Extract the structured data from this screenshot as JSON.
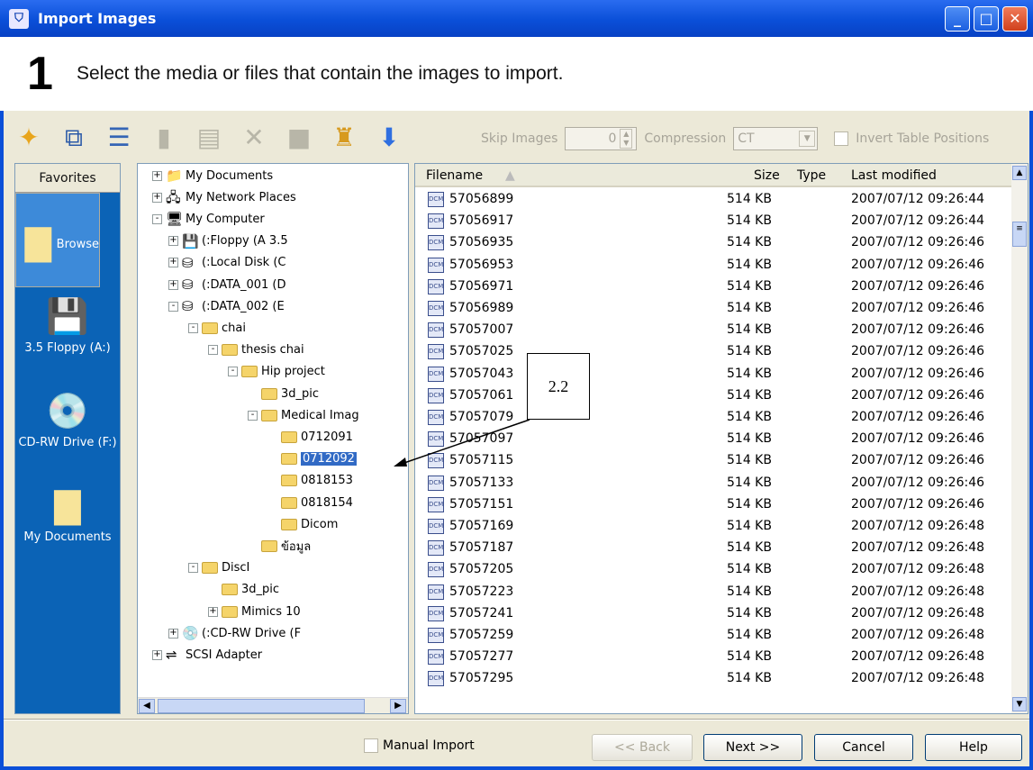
{
  "window": {
    "title": "Import Images"
  },
  "header": {
    "step_number": "1",
    "step_text": "Select the media or files that contain the images to import."
  },
  "options": {
    "skip_label": "Skip Images",
    "skip_value": "0",
    "compression_label": "Compression",
    "compression_value": "CT",
    "invert_label": "Invert Table Positions"
  },
  "favorites": {
    "header": "Favorites",
    "items": [
      {
        "label": "Browse",
        "icon": "folder-icon"
      },
      {
        "label": "3.5 Floppy (A:)",
        "icon": "floppy-icon"
      },
      {
        "label": "CD-RW Drive (F:)",
        "icon": "cd-drive-icon"
      },
      {
        "label": "My Documents",
        "icon": "documents-folder-icon"
      }
    ]
  },
  "tree": [
    {
      "label": "My Documents",
      "expander": "+",
      "icon": "documents-icon"
    },
    {
      "label": "My Network Places",
      "expander": "+",
      "icon": "network-icon"
    },
    {
      "label": "My Computer",
      "expander": "-",
      "icon": "computer-icon"
    },
    {
      "label": "(:Floppy (A 3.5",
      "expander": "+",
      "icon": "floppy-icon"
    },
    {
      "label": "(:Local Disk (C",
      "expander": "+",
      "icon": "disk-icon"
    },
    {
      "label": "(:DATA_001 (D",
      "expander": "+",
      "icon": "disk-icon"
    },
    {
      "label": "(:DATA_002 (E",
      "expander": "-",
      "icon": "disk-icon"
    },
    {
      "label": "chai",
      "expander": "-",
      "icon": "folder-icon"
    },
    {
      "label": "thesis chai",
      "expander": "-",
      "icon": "folder-icon"
    },
    {
      "label": "Hip project",
      "expander": "-",
      "icon": "folder-icon"
    },
    {
      "label": "3d_pic",
      "expander": "",
      "icon": "folder-icon"
    },
    {
      "label": "Medical Imag",
      "expander": "-",
      "icon": "folder-icon"
    },
    {
      "label": "0712091",
      "expander": "",
      "icon": "folder-icon"
    },
    {
      "label": "0712092",
      "expander": "",
      "icon": "folder-icon"
    },
    {
      "label": "0818153",
      "expander": "",
      "icon": "folder-icon"
    },
    {
      "label": "0818154",
      "expander": "",
      "icon": "folder-icon"
    },
    {
      "label": "Dicom",
      "expander": "",
      "icon": "folder-icon"
    },
    {
      "label": "ข้อมูล",
      "expander": "",
      "icon": "folder-icon"
    },
    {
      "label": "DiscI",
      "expander": "-",
      "icon": "folder-icon"
    },
    {
      "label": "3d_pic",
      "expander": "",
      "icon": "folder-icon"
    },
    {
      "label": "Mimics 10",
      "expander": "+",
      "icon": "folder-icon"
    },
    {
      "label": "(:CD-RW Drive (F",
      "expander": "+",
      "icon": "cd-icon"
    },
    {
      "label": "SCSI Adapter",
      "expander": "+",
      "icon": "scsi-icon"
    }
  ],
  "list": {
    "columns": {
      "filename": "Filename",
      "size": "Size",
      "type": "Type",
      "modified": "Last modified"
    },
    "rows": [
      {
        "name": "57056899",
        "size": "514 KB",
        "modified": "2007/07/12 09:26:44"
      },
      {
        "name": "57056917",
        "size": "514 KB",
        "modified": "2007/07/12 09:26:44"
      },
      {
        "name": "57056935",
        "size": "514 KB",
        "modified": "2007/07/12 09:26:46"
      },
      {
        "name": "57056953",
        "size": "514 KB",
        "modified": "2007/07/12 09:26:46"
      },
      {
        "name": "57056971",
        "size": "514 KB",
        "modified": "2007/07/12 09:26:46"
      },
      {
        "name": "57056989",
        "size": "514 KB",
        "modified": "2007/07/12 09:26:46"
      },
      {
        "name": "57057007",
        "size": "514 KB",
        "modified": "2007/07/12 09:26:46"
      },
      {
        "name": "57057025",
        "size": "514 KB",
        "modified": "2007/07/12 09:26:46"
      },
      {
        "name": "57057043",
        "size": "514 KB",
        "modified": "2007/07/12 09:26:46"
      },
      {
        "name": "57057061",
        "size": "514 KB",
        "modified": "2007/07/12 09:26:46"
      },
      {
        "name": "57057079",
        "size": "514 KB",
        "modified": "2007/07/12 09:26:46"
      },
      {
        "name": "57057097",
        "size": "514 KB",
        "modified": "2007/07/12 09:26:46"
      },
      {
        "name": "57057115",
        "size": "514 KB",
        "modified": "2007/07/12 09:26:46"
      },
      {
        "name": "57057133",
        "size": "514 KB",
        "modified": "2007/07/12 09:26:46"
      },
      {
        "name": "57057151",
        "size": "514 KB",
        "modified": "2007/07/12 09:26:46"
      },
      {
        "name": "57057169",
        "size": "514 KB",
        "modified": "2007/07/12 09:26:48"
      },
      {
        "name": "57057187",
        "size": "514 KB",
        "modified": "2007/07/12 09:26:48"
      },
      {
        "name": "57057205",
        "size": "514 KB",
        "modified": "2007/07/12 09:26:48"
      },
      {
        "name": "57057223",
        "size": "514 KB",
        "modified": "2007/07/12 09:26:48"
      },
      {
        "name": "57057241",
        "size": "514 KB",
        "modified": "2007/07/12 09:26:48"
      },
      {
        "name": "57057259",
        "size": "514 KB",
        "modified": "2007/07/12 09:26:48"
      },
      {
        "name": "57057277",
        "size": "514 KB",
        "modified": "2007/07/12 09:26:48"
      },
      {
        "name": "57057295",
        "size": "514 KB",
        "modified": "2007/07/12 09:26:48"
      }
    ]
  },
  "footer": {
    "manual_import": "Manual Import",
    "back": "<< Back",
    "next": "Next >>",
    "cancel": "Cancel",
    "help": "Help"
  },
  "annotation": {
    "label": "2.2"
  }
}
